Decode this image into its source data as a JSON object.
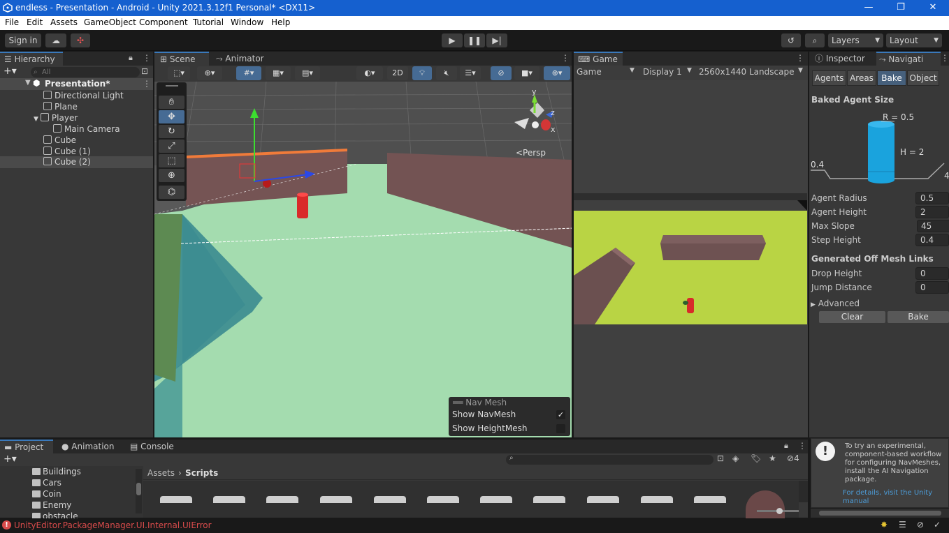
{
  "window": {
    "title": "endless - Presentation - Android - Unity 2021.3.12f1 Personal* <DX11>"
  },
  "menu": [
    "File",
    "Edit",
    "Assets",
    "GameObject",
    "Component",
    "Tutorial",
    "Window",
    "Help"
  ],
  "toolbar": {
    "sign_in": "Sign in",
    "layers": "Layers",
    "layout": "Layout"
  },
  "hierarchy": {
    "tab": "Hierarchy",
    "search_placeholder": "All",
    "scene": "Presentation*",
    "items": [
      "Directional Light",
      "Plane",
      "Player",
      "Main Camera",
      "Cube",
      "Cube (1)",
      "Cube (2)"
    ]
  },
  "scene_view": {
    "tabs": [
      "Scene",
      "Animator"
    ],
    "two_d": "2D",
    "persp": "<Persp",
    "gizmo_axes": {
      "y": "y",
      "z": "z",
      "x": "x"
    },
    "navmesh_overlay": {
      "title": "Nav Mesh",
      "show_navmesh": "Show NavMesh",
      "show_heightmesh": "Show HeightMesh"
    }
  },
  "game_view": {
    "tab": "Game",
    "mode": "Game",
    "display": "Display 1",
    "resolution": "2560x1440 Landscape"
  },
  "inspector": {
    "tabs": [
      "Inspector",
      "Navigati"
    ],
    "subtabs": [
      "Agents",
      "Areas",
      "Bake",
      "Object"
    ],
    "baked_agent_size": "Baked Agent Size",
    "diagram": {
      "r": "R = 0.5",
      "h": "H = 2",
      "step": "0.4",
      "slope": "4"
    },
    "fields": [
      {
        "label": "Agent Radius",
        "value": "0.5"
      },
      {
        "label": "Agent Height",
        "value": "2"
      },
      {
        "label": "Max Slope",
        "value": "45"
      },
      {
        "label": "Step Height",
        "value": "0.4"
      }
    ],
    "offmesh_title": "Generated Off Mesh Links",
    "offmesh_fields": [
      {
        "label": "Drop Height",
        "value": "0"
      },
      {
        "label": "Jump Distance",
        "value": "0"
      }
    ],
    "advanced": "Advanced",
    "clear": "Clear",
    "bake": "Bake",
    "help_text": "To try an experimental, component-based workflow for configuring NavMeshes, install the AI Navigation package.",
    "help_link": "For details, visit the Unity manual"
  },
  "project": {
    "tabs": [
      "Project",
      "Animation",
      "Console"
    ],
    "folders": [
      "Buildings",
      "Cars",
      "Coin",
      "Enemy",
      "obstacle"
    ],
    "breadcrumb": [
      "Assets",
      "Scripts"
    ],
    "hidden_count": "4"
  },
  "status": {
    "error": "UnityEditor.PackageManager.UI.Internal.UIError"
  },
  "colors": {
    "accent": "#3a79bb",
    "titlebar": "#1560cf",
    "navmesh": "#92d9a3",
    "game_floor": "#b9d444",
    "error": "#d84b4b"
  }
}
